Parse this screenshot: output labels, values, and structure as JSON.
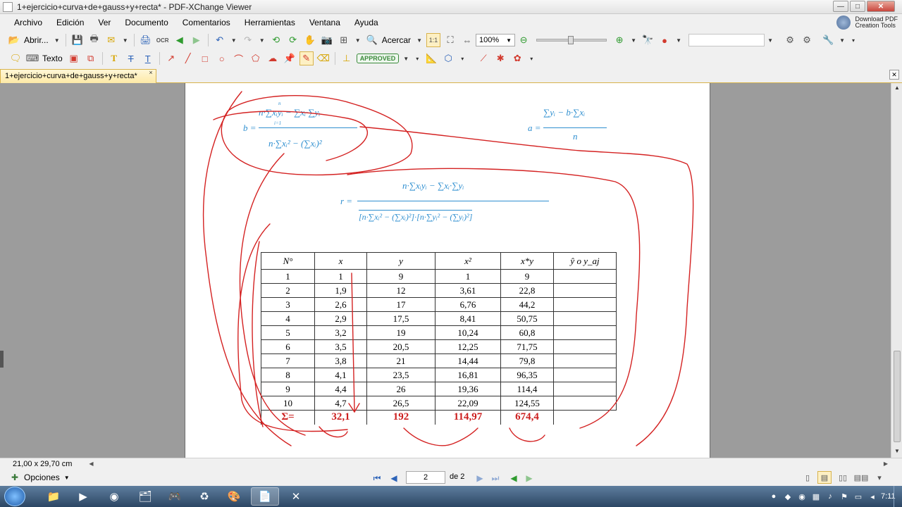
{
  "window": {
    "title": "1+ejercicio+curva+de+gauss+y+recta* - PDF-XChange Viewer",
    "controls": {
      "minimize": "—",
      "maximize": "□",
      "close": "✕"
    }
  },
  "menu": {
    "items": [
      "Archivo",
      "Edición",
      "Ver",
      "Documento",
      "Comentarios",
      "Herramientas",
      "Ventana",
      "Ayuda"
    ],
    "download_line1": "Download PDF",
    "download_line2": "Creation Tools"
  },
  "toolbar1": {
    "open_label": "Abrir...",
    "ocr_label": "OCR",
    "zoom_in_label": "Acercar",
    "zoom_value": "100%"
  },
  "toolbar2": {
    "text_label": "Texto",
    "stamp_label": "APPROVED"
  },
  "tab": {
    "label": "1+ejercicio+curva+de+gauss+y+recta*",
    "close": "×"
  },
  "formulas": {
    "b_label": "b =",
    "b_num": "n·∑xᵢyᵢ − ∑xᵢ·∑yᵢ",
    "b_den": "n·∑xᵢ² − (∑xᵢ)²",
    "a_label": "a =",
    "a_num": "∑yᵢ − b·∑xᵢ",
    "a_den": "n",
    "r_label": "r =",
    "r_num": "n·∑xᵢyᵢ − ∑xᵢ·∑yᵢ",
    "r_den": "[n·∑xᵢ² − (∑xᵢ)²]·[n·∑yᵢ² − (∑yᵢ)²]",
    "sum_limits_top": "n",
    "sum_limits_bottom": "i=1"
  },
  "table": {
    "headers": [
      "N°",
      "x",
      "y",
      "x²",
      "x*y",
      "ŷ  o  y_aj"
    ],
    "rows": [
      [
        "1",
        "1",
        "9",
        "1",
        "9",
        ""
      ],
      [
        "2",
        "1,9",
        "12",
        "3,61",
        "22,8",
        ""
      ],
      [
        "3",
        "2,6",
        "17",
        "6,76",
        "44,2",
        ""
      ],
      [
        "4",
        "2,9",
        "17,5",
        "8,41",
        "50,75",
        ""
      ],
      [
        "5",
        "3,2",
        "19",
        "10,24",
        "60,8",
        ""
      ],
      [
        "6",
        "3,5",
        "20,5",
        "12,25",
        "71,75",
        ""
      ],
      [
        "7",
        "3,8",
        "21",
        "14,44",
        "79,8",
        ""
      ],
      [
        "8",
        "4,1",
        "23,5",
        "16,81",
        "96,35",
        ""
      ],
      [
        "9",
        "4,4",
        "26",
        "19,36",
        "114,4",
        ""
      ],
      [
        "10",
        "4,7",
        "26,5",
        "22,09",
        "124,55",
        ""
      ]
    ],
    "sums": [
      "Σ=",
      "32,1",
      "192",
      "114,97",
      "674,4"
    ]
  },
  "status": {
    "page_size": "21,00 x 29,70 cm"
  },
  "nav": {
    "options_label": "Opciones",
    "current_page": "2",
    "of_pages": "de 2"
  },
  "taskbar": {
    "clock": "7:11"
  },
  "colors": {
    "formula_blue": "#2f8fd0",
    "ink_red": "#d42222",
    "sum_red": "#cc1f1f",
    "viewer_gray": "#9c9c9c",
    "tab_yellow": "#fde9a6"
  }
}
